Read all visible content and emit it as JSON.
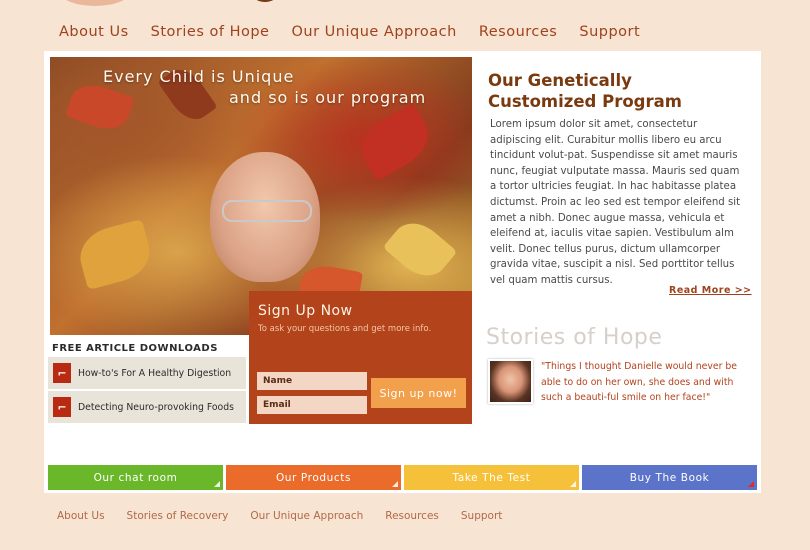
{
  "top_nav": {
    "items": [
      "About Us",
      "Stories of Hope",
      "Our Unique Approach",
      "Resources",
      "Support"
    ]
  },
  "hero": {
    "line1": "Every Child is Unique",
    "line2": "and so is our program"
  },
  "program": {
    "title_line1": "Our Genetically",
    "title_line2": "Customized Program",
    "body": "Lorem ipsum dolor sit amet, consectetur adipiscing elit. Curabitur mollis libero eu arcu tincidunt volut-pat. Suspendisse sit amet mauris nunc, feugiat vulputate massa. Mauris sed quam a tortor ultricies feugiat. In hac habitasse platea dictumst. Proin ac leo sed est tempor eleifend sit amet a nibh. Donec augue massa, vehicula et eleifend at, iaculis vitae sapien. Vestibulum alm velit. Donec tellus purus, dictum ullamcorper gravida vitae, suscipit a nisl. Sed porttitor tellus vel quam mattis cursus.",
    "read_more": "Read More >>"
  },
  "stories": {
    "title": "Stories of Hope",
    "quote": "\"Things I thought Danielle would never be able to do on her own, she does and with such a beauti-ful smile on her face!\""
  },
  "downloads": {
    "title": "FREE ARTICLE DOWNLOADS",
    "items": [
      "How-to's For A Healthy Digestion",
      "Detecting Neuro-provoking Foods"
    ]
  },
  "signup": {
    "title": "Sign Up Now",
    "subtitle": "To ask your questions and get more info.",
    "name_placeholder": "Name",
    "email_placeholder": "Email",
    "button": "Sign up now!"
  },
  "tiles": [
    {
      "label": "Our chat room",
      "color": "#6ab82a"
    },
    {
      "label": "Our Products",
      "color": "#ea6b2a"
    },
    {
      "label": "Take The Test",
      "color": "#f6c13a"
    },
    {
      "label": "Buy The Book",
      "color": "#5b73c8"
    }
  ],
  "footer_nav": {
    "items": [
      "About Us",
      "Stories of Recovery",
      "Our Unique Approach",
      "Resources",
      "Support"
    ]
  }
}
